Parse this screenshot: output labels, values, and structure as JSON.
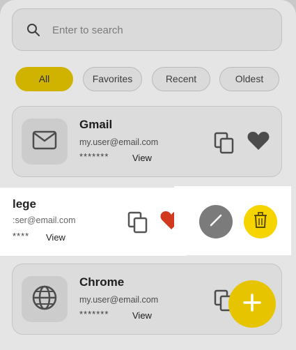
{
  "search": {
    "placeholder": "Enter to search",
    "icon": "search-icon"
  },
  "filters": [
    {
      "label": "All",
      "active": true
    },
    {
      "label": "Favorites",
      "active": false
    },
    {
      "label": "Recent",
      "active": false
    },
    {
      "label": "Oldest",
      "active": false
    }
  ],
  "entries": [
    {
      "title": "Gmail",
      "email": "my.user@email.com",
      "password_mask": "*******",
      "view_label": "View",
      "icon": "mail-icon",
      "favorite_color": "#555555"
    },
    {
      "title": "lege",
      "email": ":ser@email.com",
      "password_mask": "****",
      "view_label": "View",
      "favorite_color": "#d13a1e"
    },
    {
      "title": "Chrome",
      "email": "my.user@email.com",
      "password_mask": "*******",
      "view_label": "View",
      "icon": "globe-icon"
    }
  ],
  "actions": {
    "edit_icon": "pencil-icon",
    "delete_icon": "trash-icon",
    "edit_color": "#7b7b7b",
    "delete_color": "#f6d400"
  },
  "fab": {
    "icon": "plus-icon",
    "color": "#e7c400"
  },
  "colors": {
    "accent": "#e8c800"
  }
}
